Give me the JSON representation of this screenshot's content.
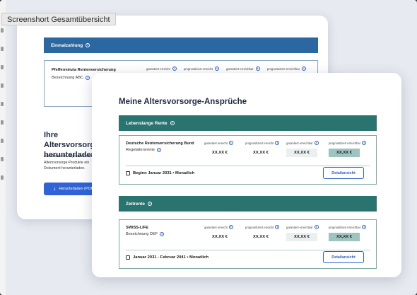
{
  "window": {
    "tab_label": "Screenshort Gesamtübersicht"
  },
  "back_card": {
    "bar_title": "Einmalzahlung",
    "item_name": "Pfefferminzia Rentenversicherung",
    "item_sub": "Bezeichnung ABC",
    "columns": [
      "garantiert erreicht",
      "prognostiziert erreicht",
      "garantiert erreichbar",
      "prognostiziert erreichbar"
    ],
    "heading": "Ihre Altersvorsorge herunterladen",
    "text": "Alle Daten der Digitalen Rente Altersvorsorge-Produkte ein Dokument herunterladen.",
    "download_label": "Herunterladen (PDF)"
  },
  "front_card": {
    "title": "Meine Altersvorsorge-Ansprüche",
    "sections": [
      {
        "bar_title": "Lebenslange Rente",
        "name": "Deutsche Rentenversicherung Bund",
        "sub": "Regelaltersrente",
        "columns": [
          "garantiert erreicht",
          "prognostiziert erreicht",
          "garantiert erreichbar",
          "prognostiziert erreichbar"
        ],
        "values": [
          "XX,XX €",
          "XX,XX €",
          "XX,XX €",
          "XX,XX €"
        ],
        "date": "Beginn Januar 2031 • Monatlich",
        "button": "Detailansicht"
      },
      {
        "bar_title": "Zeitrente",
        "name": "SWISS-LIFE",
        "sub": "Bezeichnung DEF",
        "columns": [
          "garantiert erreicht",
          "prognostiziert erreicht",
          "garantiert erreichbar",
          "prognostiziert erreichbar"
        ],
        "values": [
          "XX,XX €",
          "XX,XX €",
          "XX,XX €",
          "XX,XX €"
        ],
        "date": "Januar 2031 - Februar 2041 • Monatlich",
        "button": "Detailansicht"
      }
    ]
  },
  "colors": {
    "blue_bar": "#2b67a0",
    "teal_bar": "#2a7470",
    "button_blue": "#2f63d6"
  },
  "icons": [
    "info-icon",
    "download-icon",
    "calendar-icon"
  ]
}
